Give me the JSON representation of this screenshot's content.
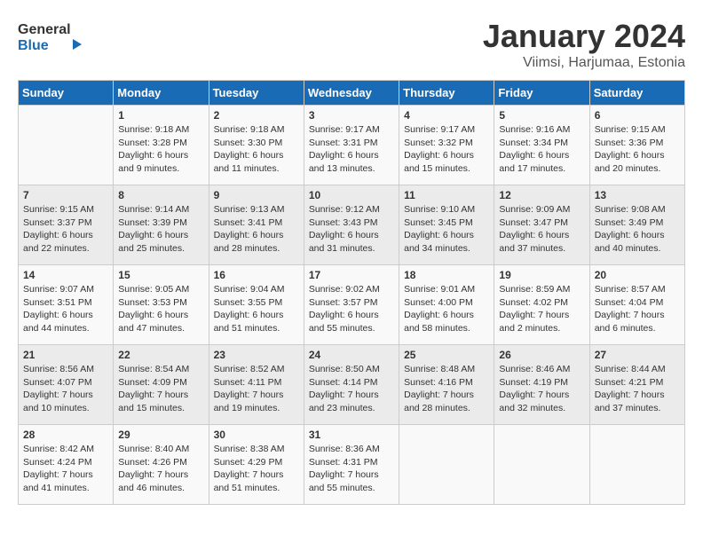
{
  "header": {
    "logo_line1": "General",
    "logo_line2": "Blue",
    "title": "January 2024",
    "subtitle": "Viimsi, Harjumaa, Estonia"
  },
  "weekdays": [
    "Sunday",
    "Monday",
    "Tuesday",
    "Wednesday",
    "Thursday",
    "Friday",
    "Saturday"
  ],
  "weeks": [
    [
      {
        "day": "",
        "sunrise": "",
        "sunset": "",
        "daylight": ""
      },
      {
        "day": "1",
        "sunrise": "Sunrise: 9:18 AM",
        "sunset": "Sunset: 3:28 PM",
        "daylight": "Daylight: 6 hours and 9 minutes."
      },
      {
        "day": "2",
        "sunrise": "Sunrise: 9:18 AM",
        "sunset": "Sunset: 3:30 PM",
        "daylight": "Daylight: 6 hours and 11 minutes."
      },
      {
        "day": "3",
        "sunrise": "Sunrise: 9:17 AM",
        "sunset": "Sunset: 3:31 PM",
        "daylight": "Daylight: 6 hours and 13 minutes."
      },
      {
        "day": "4",
        "sunrise": "Sunrise: 9:17 AM",
        "sunset": "Sunset: 3:32 PM",
        "daylight": "Daylight: 6 hours and 15 minutes."
      },
      {
        "day": "5",
        "sunrise": "Sunrise: 9:16 AM",
        "sunset": "Sunset: 3:34 PM",
        "daylight": "Daylight: 6 hours and 17 minutes."
      },
      {
        "day": "6",
        "sunrise": "Sunrise: 9:15 AM",
        "sunset": "Sunset: 3:36 PM",
        "daylight": "Daylight: 6 hours and 20 minutes."
      }
    ],
    [
      {
        "day": "7",
        "sunrise": "Sunrise: 9:15 AM",
        "sunset": "Sunset: 3:37 PM",
        "daylight": "Daylight: 6 hours and 22 minutes."
      },
      {
        "day": "8",
        "sunrise": "Sunrise: 9:14 AM",
        "sunset": "Sunset: 3:39 PM",
        "daylight": "Daylight: 6 hours and 25 minutes."
      },
      {
        "day": "9",
        "sunrise": "Sunrise: 9:13 AM",
        "sunset": "Sunset: 3:41 PM",
        "daylight": "Daylight: 6 hours and 28 minutes."
      },
      {
        "day": "10",
        "sunrise": "Sunrise: 9:12 AM",
        "sunset": "Sunset: 3:43 PM",
        "daylight": "Daylight: 6 hours and 31 minutes."
      },
      {
        "day": "11",
        "sunrise": "Sunrise: 9:10 AM",
        "sunset": "Sunset: 3:45 PM",
        "daylight": "Daylight: 6 hours and 34 minutes."
      },
      {
        "day": "12",
        "sunrise": "Sunrise: 9:09 AM",
        "sunset": "Sunset: 3:47 PM",
        "daylight": "Daylight: 6 hours and 37 minutes."
      },
      {
        "day": "13",
        "sunrise": "Sunrise: 9:08 AM",
        "sunset": "Sunset: 3:49 PM",
        "daylight": "Daylight: 6 hours and 40 minutes."
      }
    ],
    [
      {
        "day": "14",
        "sunrise": "Sunrise: 9:07 AM",
        "sunset": "Sunset: 3:51 PM",
        "daylight": "Daylight: 6 hours and 44 minutes."
      },
      {
        "day": "15",
        "sunrise": "Sunrise: 9:05 AM",
        "sunset": "Sunset: 3:53 PM",
        "daylight": "Daylight: 6 hours and 47 minutes."
      },
      {
        "day": "16",
        "sunrise": "Sunrise: 9:04 AM",
        "sunset": "Sunset: 3:55 PM",
        "daylight": "Daylight: 6 hours and 51 minutes."
      },
      {
        "day": "17",
        "sunrise": "Sunrise: 9:02 AM",
        "sunset": "Sunset: 3:57 PM",
        "daylight": "Daylight: 6 hours and 55 minutes."
      },
      {
        "day": "18",
        "sunrise": "Sunrise: 9:01 AM",
        "sunset": "Sunset: 4:00 PM",
        "daylight": "Daylight: 6 hours and 58 minutes."
      },
      {
        "day": "19",
        "sunrise": "Sunrise: 8:59 AM",
        "sunset": "Sunset: 4:02 PM",
        "daylight": "Daylight: 7 hours and 2 minutes."
      },
      {
        "day": "20",
        "sunrise": "Sunrise: 8:57 AM",
        "sunset": "Sunset: 4:04 PM",
        "daylight": "Daylight: 7 hours and 6 minutes."
      }
    ],
    [
      {
        "day": "21",
        "sunrise": "Sunrise: 8:56 AM",
        "sunset": "Sunset: 4:07 PM",
        "daylight": "Daylight: 7 hours and 10 minutes."
      },
      {
        "day": "22",
        "sunrise": "Sunrise: 8:54 AM",
        "sunset": "Sunset: 4:09 PM",
        "daylight": "Daylight: 7 hours and 15 minutes."
      },
      {
        "day": "23",
        "sunrise": "Sunrise: 8:52 AM",
        "sunset": "Sunset: 4:11 PM",
        "daylight": "Daylight: 7 hours and 19 minutes."
      },
      {
        "day": "24",
        "sunrise": "Sunrise: 8:50 AM",
        "sunset": "Sunset: 4:14 PM",
        "daylight": "Daylight: 7 hours and 23 minutes."
      },
      {
        "day": "25",
        "sunrise": "Sunrise: 8:48 AM",
        "sunset": "Sunset: 4:16 PM",
        "daylight": "Daylight: 7 hours and 28 minutes."
      },
      {
        "day": "26",
        "sunrise": "Sunrise: 8:46 AM",
        "sunset": "Sunset: 4:19 PM",
        "daylight": "Daylight: 7 hours and 32 minutes."
      },
      {
        "day": "27",
        "sunrise": "Sunrise: 8:44 AM",
        "sunset": "Sunset: 4:21 PM",
        "daylight": "Daylight: 7 hours and 37 minutes."
      }
    ],
    [
      {
        "day": "28",
        "sunrise": "Sunrise: 8:42 AM",
        "sunset": "Sunset: 4:24 PM",
        "daylight": "Daylight: 7 hours and 41 minutes."
      },
      {
        "day": "29",
        "sunrise": "Sunrise: 8:40 AM",
        "sunset": "Sunset: 4:26 PM",
        "daylight": "Daylight: 7 hours and 46 minutes."
      },
      {
        "day": "30",
        "sunrise": "Sunrise: 8:38 AM",
        "sunset": "Sunset: 4:29 PM",
        "daylight": "Daylight: 7 hours and 51 minutes."
      },
      {
        "day": "31",
        "sunrise": "Sunrise: 8:36 AM",
        "sunset": "Sunset: 4:31 PM",
        "daylight": "Daylight: 7 hours and 55 minutes."
      },
      {
        "day": "",
        "sunrise": "",
        "sunset": "",
        "daylight": ""
      },
      {
        "day": "",
        "sunrise": "",
        "sunset": "",
        "daylight": ""
      },
      {
        "day": "",
        "sunrise": "",
        "sunset": "",
        "daylight": ""
      }
    ]
  ]
}
